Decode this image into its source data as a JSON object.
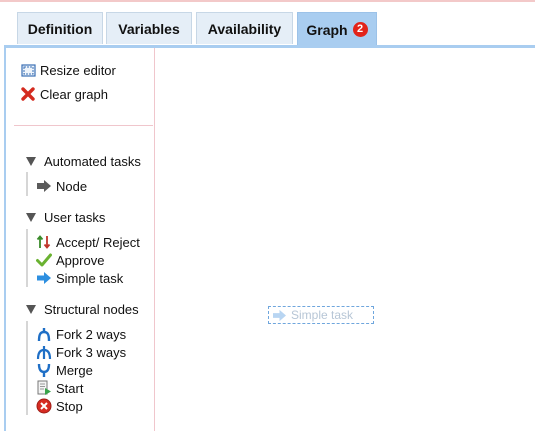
{
  "tabs": [
    {
      "label": "Definition"
    },
    {
      "label": "Variables"
    },
    {
      "label": "Availability"
    },
    {
      "label": "Graph",
      "badge": "2",
      "active": true
    }
  ],
  "toolbar": {
    "resize_label": "Resize editor",
    "clear_label": "Clear graph"
  },
  "groups": {
    "automated": {
      "label": "Automated tasks",
      "items": [
        {
          "label": "Node",
          "icon": "arrow-right-icon"
        }
      ]
    },
    "user": {
      "label": "User tasks",
      "items": [
        {
          "label": "Accept/ Reject",
          "icon": "accept-reject-icon"
        },
        {
          "label": "Approve",
          "icon": "checkmark-icon"
        },
        {
          "label": "Simple task",
          "icon": "blue-arrow-icon"
        }
      ]
    },
    "structural": {
      "label": "Structural nodes",
      "items": [
        {
          "label": "Fork 2 ways",
          "icon": "fork-2-icon"
        },
        {
          "label": "Fork 3 ways",
          "icon": "fork-3-icon"
        },
        {
          "label": "Merge",
          "icon": "merge-icon"
        },
        {
          "label": "Start",
          "icon": "start-icon"
        },
        {
          "label": "Stop",
          "icon": "stop-icon"
        }
      ]
    }
  },
  "canvas": {
    "drag_ghost_label": "Simple task"
  },
  "colors": {
    "tab_bg": "#e5eef7",
    "tab_active": "#a9cdf0",
    "badge": "#e2231a",
    "divider": "#f0c6cc"
  }
}
